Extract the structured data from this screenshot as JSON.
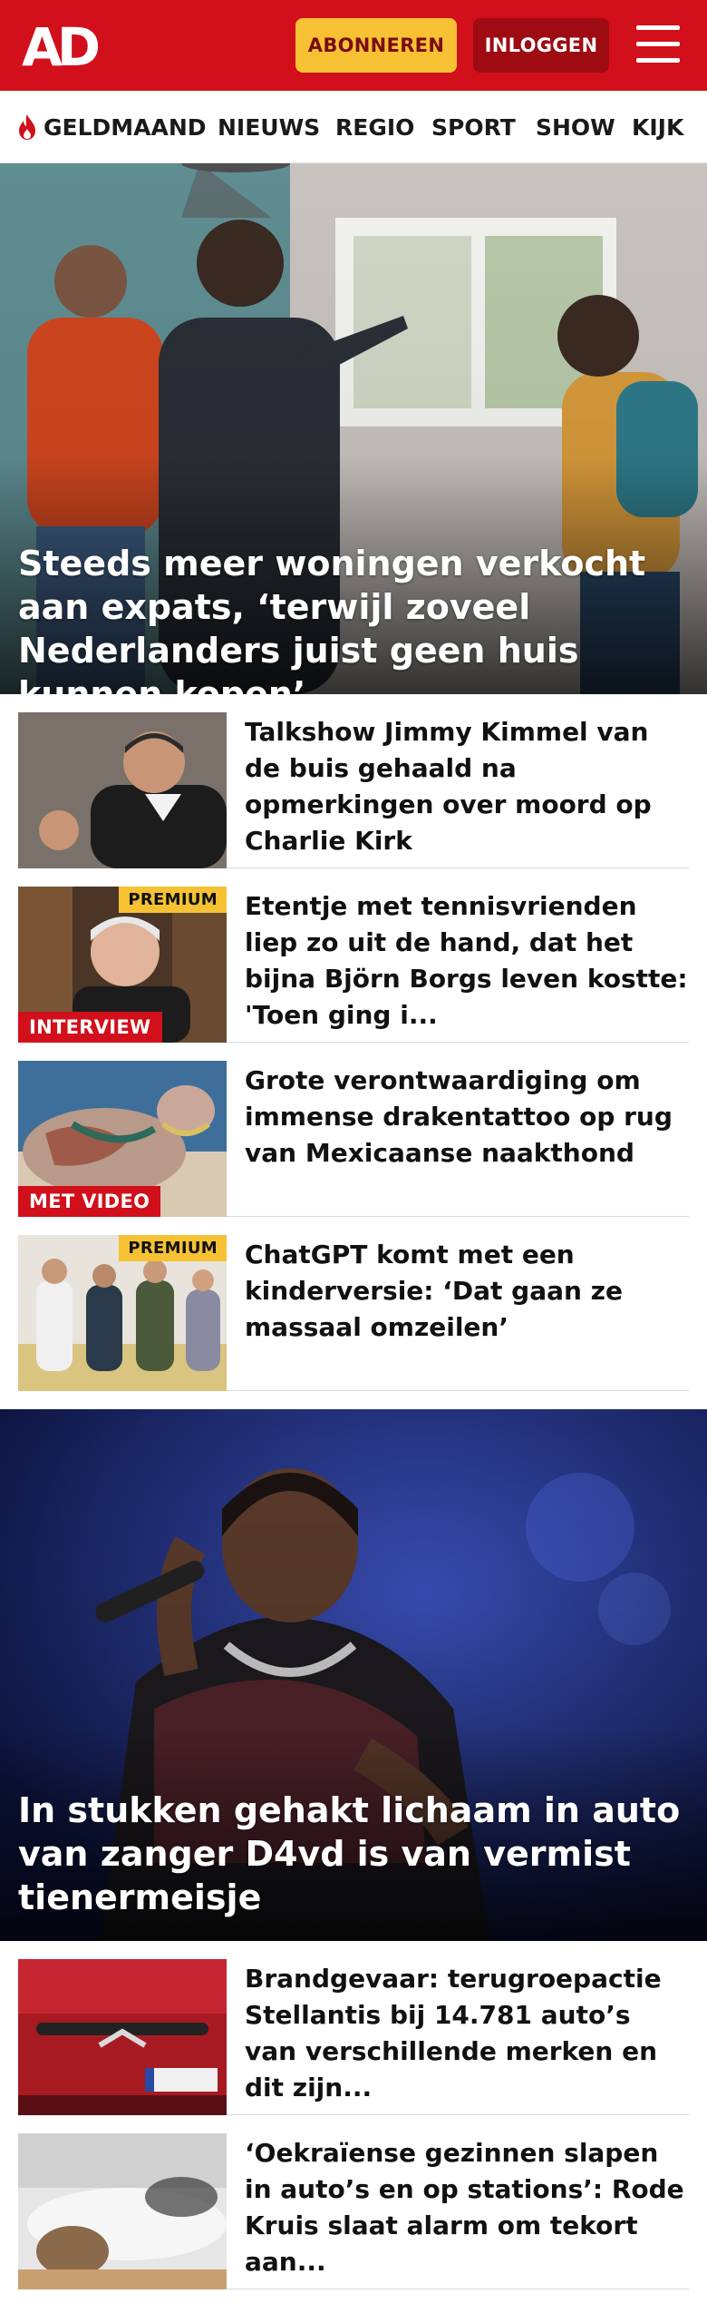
{
  "header": {
    "logo_text": "AD",
    "subscribe_label": "ABONNEREN",
    "login_label": "INLOGGEN",
    "brand_color": "#d1101b",
    "accent_color": "#f6c234"
  },
  "nav": {
    "items": [
      {
        "label": "GELDMAAND",
        "icon": "flame-icon"
      },
      {
        "label": "NIEUWS"
      },
      {
        "label": "REGIO"
      },
      {
        "label": "SPORT"
      },
      {
        "label": "SHOW"
      },
      {
        "label": "KIJK"
      }
    ]
  },
  "hero1": {
    "title": "Steeds meer woningen verkocht aan expats, ‘terwijl zoveel Nederlanders juist geen huis kunnen kopen’"
  },
  "articles1": [
    {
      "title": "Talkshow Jimmy Kimmel van de buis gehaald na opmerkingen over moord op Charlie Kirk"
    },
    {
      "title": "Etentje met tennisvrienden liep zo uit de hand, dat het bijna Björn Borgs leven kostte: 'Toen ging i...",
      "premium": "PREMIUM",
      "tag": "INTERVIEW"
    },
    {
      "title": "Grote verontwaardiging om immense drakentattoo op rug van Mexicaanse naakthond",
      "tag": "MET VIDEO"
    },
    {
      "title": "ChatGPT komt met een kinderversie: ‘Dat gaan ze massaal omzeilen’",
      "premium": "PREMIUM"
    }
  ],
  "hero2": {
    "title": "In stukken gehakt lichaam in auto van zanger D4vd is van vermist tienermeisje"
  },
  "articles2": [
    {
      "title": "Brandgevaar: terugroepactie Stellantis bij 14.781 auto’s van verschillende merken en dit zijn..."
    },
    {
      "title": "‘Oekraïense gezinnen slapen in auto’s en op stations’: Rode Kruis slaat alarm om tekort aan..."
    }
  ]
}
